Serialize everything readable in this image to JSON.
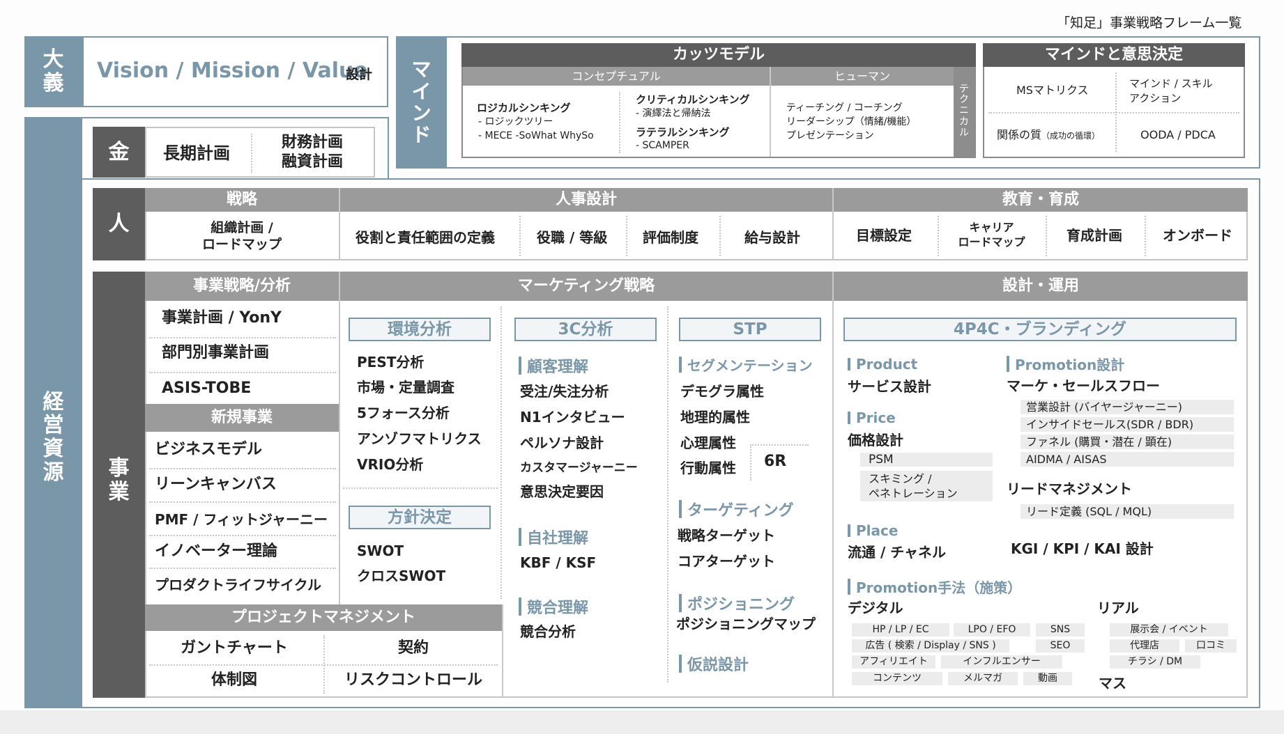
{
  "header": {
    "title": "「知足」事業戦略フレーム一覧"
  },
  "taigi": {
    "label": [
      "大",
      "義"
    ],
    "vmv": "Vision / Mission / Value",
    "sekkei": "設計"
  },
  "keiei": {
    "label": [
      "経",
      "営",
      "資",
      "源"
    ]
  },
  "kin": {
    "label": "金",
    "long_plan": "長期計画",
    "finance": [
      "財務計画",
      "融資計画"
    ]
  },
  "mind": {
    "label": [
      "マ",
      "イ",
      "ン",
      "ド"
    ],
    "katz": {
      "title": "カッツモデル",
      "conceptual": "コンセプチュアル",
      "human": "ヒューマン",
      "technical": [
        "テ",
        "ク",
        "ニ",
        "カ",
        "ル"
      ],
      "logical_title": "ロジカルシンキング",
      "logical_items": [
        "- ロジックツリー",
        "- MECE -SoWhat WhySo"
      ],
      "critical_title": "クリティカルシンキング",
      "critical_items": [
        "- 演繹法と帰納法"
      ],
      "lateral_title": "ラテラルシンキング",
      "lateral_items": [
        "- SCAMPER"
      ],
      "human_items": [
        "ティーチング / コーチング",
        "リーダーシップ（情緒/機能）",
        "プレゼンテーション"
      ]
    },
    "decision": {
      "title": "マインドと意思決定",
      "ms_matrix": "MSマトリクス",
      "mind_skill": [
        "マインド / スキル",
        "アクション"
      ],
      "relation": "関係の質",
      "relation_note": "（成功の循環）",
      "ooda": "OODA / PDCA"
    }
  },
  "hito": {
    "label": "人",
    "senryaku": {
      "header": "戦略",
      "item": [
        "組織計画 /",
        "ロードマップ"
      ]
    },
    "jinji": {
      "header": "人事設計",
      "items": [
        "役割と責任範囲の定義",
        "役職 / 等級",
        "評価制度",
        "給与設計"
      ]
    },
    "kyoiku": {
      "header": "教育・育成",
      "items": [
        "目標設定",
        "キャリア",
        "ロードマップ",
        "育成計画",
        "オンボード"
      ]
    }
  },
  "jigyo": {
    "label": [
      "事",
      "業"
    ],
    "analysis": {
      "header": "事業戦略/分析",
      "items": [
        "事業計画 / YonY",
        "部門別事業計画",
        "ASIS-TOBE"
      ],
      "new_header": "新規事業",
      "new_items": [
        "ビジネスモデル",
        "リーンキャンバス",
        "PMF / フィットジャーニー",
        "イノベーター理論",
        "プロダクトライフサイクル"
      ]
    },
    "pm": {
      "header": "プロジェクトマネジメント",
      "items": [
        "ガントチャート",
        "契約",
        "体制図",
        "リスクコントロール"
      ]
    },
    "marketing": {
      "header": "マーケティング戦略",
      "env": {
        "title": "環境分析",
        "items": [
          "PEST分析",
          "市場・定量調査",
          "5フォース分析",
          "アンゾフマトリクス",
          "VRIO分析"
        ]
      },
      "policy": {
        "title": "方針決定",
        "items": [
          "SWOT",
          "クロスSWOT"
        ]
      },
      "c3": {
        "title": "3C分析",
        "customer": "顧客理解",
        "customer_items": [
          "受注/失注分析",
          "N1インタビュー",
          "ペルソナ設計",
          "カスタマージャーニー",
          "意思決定要因"
        ],
        "company": "自社理解",
        "company_items": [
          "KBF / KSF"
        ],
        "competitor": "競合理解",
        "competitor_items": [
          "競合分析"
        ]
      },
      "stp": {
        "title": "STP",
        "seg": "セグメンテーション",
        "seg_items": [
          "デモグラ属性",
          "地理的属性",
          "心理属性",
          "行動属性"
        ],
        "sixr": "6R",
        "target": "ターゲティング",
        "target_items": [
          "戦略ターゲット",
          "コアターゲット"
        ],
        "pos": "ポジショニング",
        "pos_items": [
          "ポジショニングマップ"
        ],
        "hypo": "仮説設計"
      }
    },
    "design": {
      "header": "設計・運用",
      "branding": "4P4C・ブランディング",
      "product": "Product",
      "product_item": "サービス設計",
      "price": "Price",
      "price_item": "価格設計",
      "price_chips": [
        "PSM",
        "スキミング /",
        "ペネトレーション"
      ],
      "place": "Place",
      "place_item": "流通 / チャネル",
      "promo_design": "Promotion設計",
      "promo_flow": "マーケ・セールスフロー",
      "promo_chips": [
        "営業設計 (バイヤージャーニー)",
        "インサイドセールス(SDR / BDR)",
        "ファネル (購買・潜在 / 顕在)",
        "AIDMA / AISAS"
      ],
      "lead": "リードマネジメント",
      "lead_chip": "リード定義 (SQL / MQL)",
      "kgi": "KGI / KPI / KAI 設計",
      "promo_method": "Promotion手法（施策）",
      "digital": "デジタル",
      "digital_chips": [
        "HP / LP / EC",
        "LPO / EFO",
        "SNS",
        "広告 ( 検索 / Display / SNS )",
        "SEO",
        "アフィリエイト",
        "インフルエンサー",
        "コンテンツ",
        "メルマガ",
        "動画"
      ],
      "real": "リアル",
      "real_chips": [
        "展示会 / イベント",
        "代理店",
        "口コミ",
        "チラシ / DM"
      ],
      "mass": "マス"
    }
  }
}
